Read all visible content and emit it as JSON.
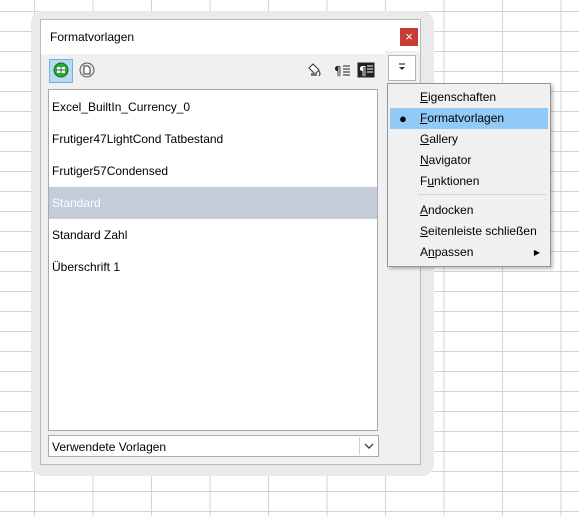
{
  "window": {
    "title": "Formatvorlagen",
    "close_label": "×"
  },
  "toolbar": {
    "cell_styles_icon": "cell-styles-icon",
    "page_styles_icon": "page-styles-icon",
    "fill_format_icon": "fill-format-mode-icon",
    "new_style_icon": "new-style-from-selection-icon",
    "update_style_icon": "update-style-icon"
  },
  "styles_list": {
    "items": [
      {
        "label": "Excel_BuiltIn_Currency_0",
        "selected": false
      },
      {
        "label": "Frutiger47LightCond Tatbestand",
        "selected": false
      },
      {
        "label": "Frutiger57Condensed",
        "selected": false
      },
      {
        "label": "Standard",
        "selected": true
      },
      {
        "label": "Standard Zahl",
        "selected": false
      },
      {
        "label": "Überschrift 1",
        "selected": false
      }
    ]
  },
  "filter": {
    "value": "Verwendete Vorlagen"
  },
  "menu": {
    "items": [
      {
        "accel": "E",
        "rest": "igenschaften",
        "current": false
      },
      {
        "accel": "F",
        "rest": "ormatvorlagen",
        "current": true
      },
      {
        "accel": "G",
        "rest": "allery",
        "current": false
      },
      {
        "accel": "N",
        "rest": "avigator",
        "current": false
      },
      {
        "pre": "F",
        "accel": "u",
        "rest": "nktionen",
        "current": false
      },
      {
        "accel": "A",
        "rest": "ndocken",
        "current": false
      },
      {
        "accel": "S",
        "rest": "eitenleiste schließen",
        "current": false
      },
      {
        "pre": "A",
        "accel": "n",
        "rest": "passen",
        "current": false,
        "submenu": true
      }
    ],
    "bullet": "●",
    "submenu_arrow": "▶"
  },
  "colors": {
    "selection": "#c3ccd8",
    "menu_highlight": "#91c9f7",
    "close_button": "#c63b35",
    "active_tool": "#b7d9f2"
  }
}
